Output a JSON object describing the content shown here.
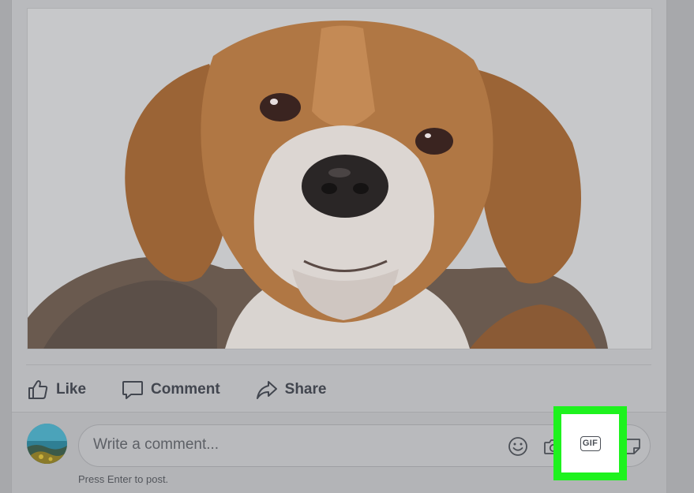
{
  "post": {
    "photo": {
      "subject_icon": "dog-photo"
    },
    "actions": [
      {
        "label": "Like",
        "icon": "thumbs-up-icon"
      },
      {
        "label": "Comment",
        "icon": "speech-bubble-icon"
      },
      {
        "label": "Share",
        "icon": "share-arrow-icon"
      }
    ]
  },
  "comment_composer": {
    "avatar_icon": "user-avatar",
    "placeholder": "Write a comment...",
    "value": "",
    "tools": [
      {
        "name": "emoji",
        "icon": "smiley-icon"
      },
      {
        "name": "photo",
        "icon": "camera-icon"
      },
      {
        "name": "gif",
        "icon": "gif-icon",
        "label": "GIF",
        "highlighted": true
      },
      {
        "name": "sticker",
        "icon": "sticker-icon"
      }
    ],
    "hint": "Press Enter to post."
  },
  "colors": {
    "highlight": "#1ef21e",
    "text_action": "#42464f"
  }
}
